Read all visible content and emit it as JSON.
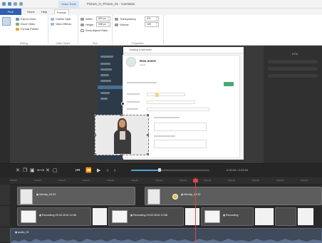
{
  "window": {
    "title": "Picture_in_Picture_01 - Camtasia",
    "context_tab": "Video Tools"
  },
  "ribbon_tabs": [
    "FILE",
    "Home",
    "Help",
    "Format"
  ],
  "ribbon": {
    "groups": [
      {
        "label": "Editing",
        "items": [
          "Export Video",
          "Excel Video",
          "Format Painter"
        ]
      },
      {
        "label": "Video Styles",
        "items": [
          "Outline Style",
          "Video Effects"
        ]
      },
      {
        "label": "Size",
        "items": [
          "Width",
          "Height",
          "Keep Aspect Ratio"
        ]
      },
      {
        "label": "Properties",
        "items": [
          "Transparency",
          "Volume"
        ]
      }
    ],
    "spinners": {
      "width": "600 px",
      "height": "338 px",
      "transparency": "0%",
      "volume": "100"
    }
  },
  "canvas": {
    "zoom": "67%"
  },
  "app_preview": {
    "header": "Creating a new event",
    "name": "New event",
    "subtitle": "details"
  },
  "playback": {
    "timecode": "0:00:25 / 0:03:04"
  },
  "timeline": {
    "ruler_ticks": [
      "0:00:00",
      "0:00:05",
      "0:00:10",
      "0:00:15",
      "0:00:20",
      "0:00:25",
      "0:00:30",
      "0:00:35",
      "0:00:40",
      "0:00:45",
      "0:00:50",
      "0:00:55",
      "0:01:00"
    ],
    "video_clips": [
      {
        "label": "Wendy_29.02"
      },
      {
        "label": "Wendy_29.02"
      }
    ],
    "screen_clips": [
      {
        "label": "Recording 29.02.2016 12:56"
      },
      {
        "label": "Recording 29.02.2016 12:56"
      },
      {
        "label": "Recording"
      }
    ],
    "audio_clip": {
      "label": "audio_01"
    }
  },
  "colors": {
    "accent": "#2f5fb3",
    "playhead": "#e04848",
    "green_button": "#49a86f"
  }
}
